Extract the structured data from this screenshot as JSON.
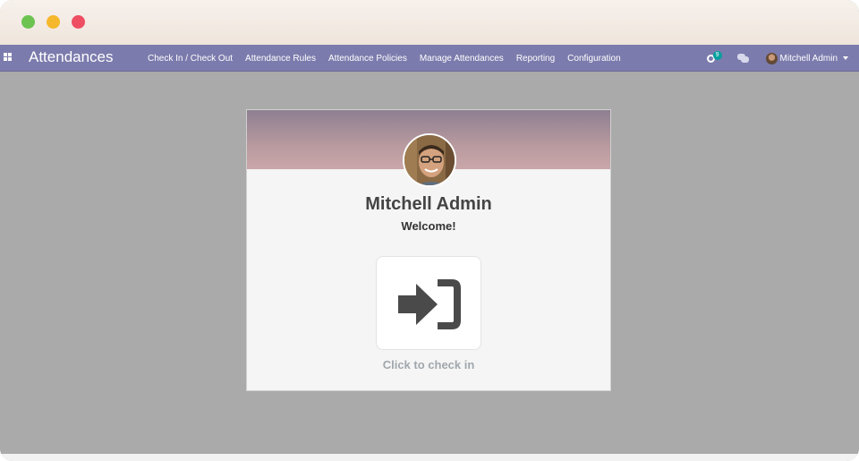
{
  "navbar": {
    "apps_icon": "apps-grid-icon",
    "brand": "Attendances",
    "menu": [
      {
        "label": "Check In / Check Out"
      },
      {
        "label": "Attendance Rules"
      },
      {
        "label": "Attendance Policies"
      },
      {
        "label": "Manage Attendances"
      },
      {
        "label": "Reporting"
      },
      {
        "label": "Configuration"
      }
    ],
    "activity_badge": "9",
    "user_name": "Mitchell Admin",
    "accent_color": "#7c7bad"
  },
  "card": {
    "employee_name": "Mitchell Admin",
    "welcome": "Welcome!",
    "action_icon": "sign-in-icon",
    "action_label": "Click to check in"
  }
}
